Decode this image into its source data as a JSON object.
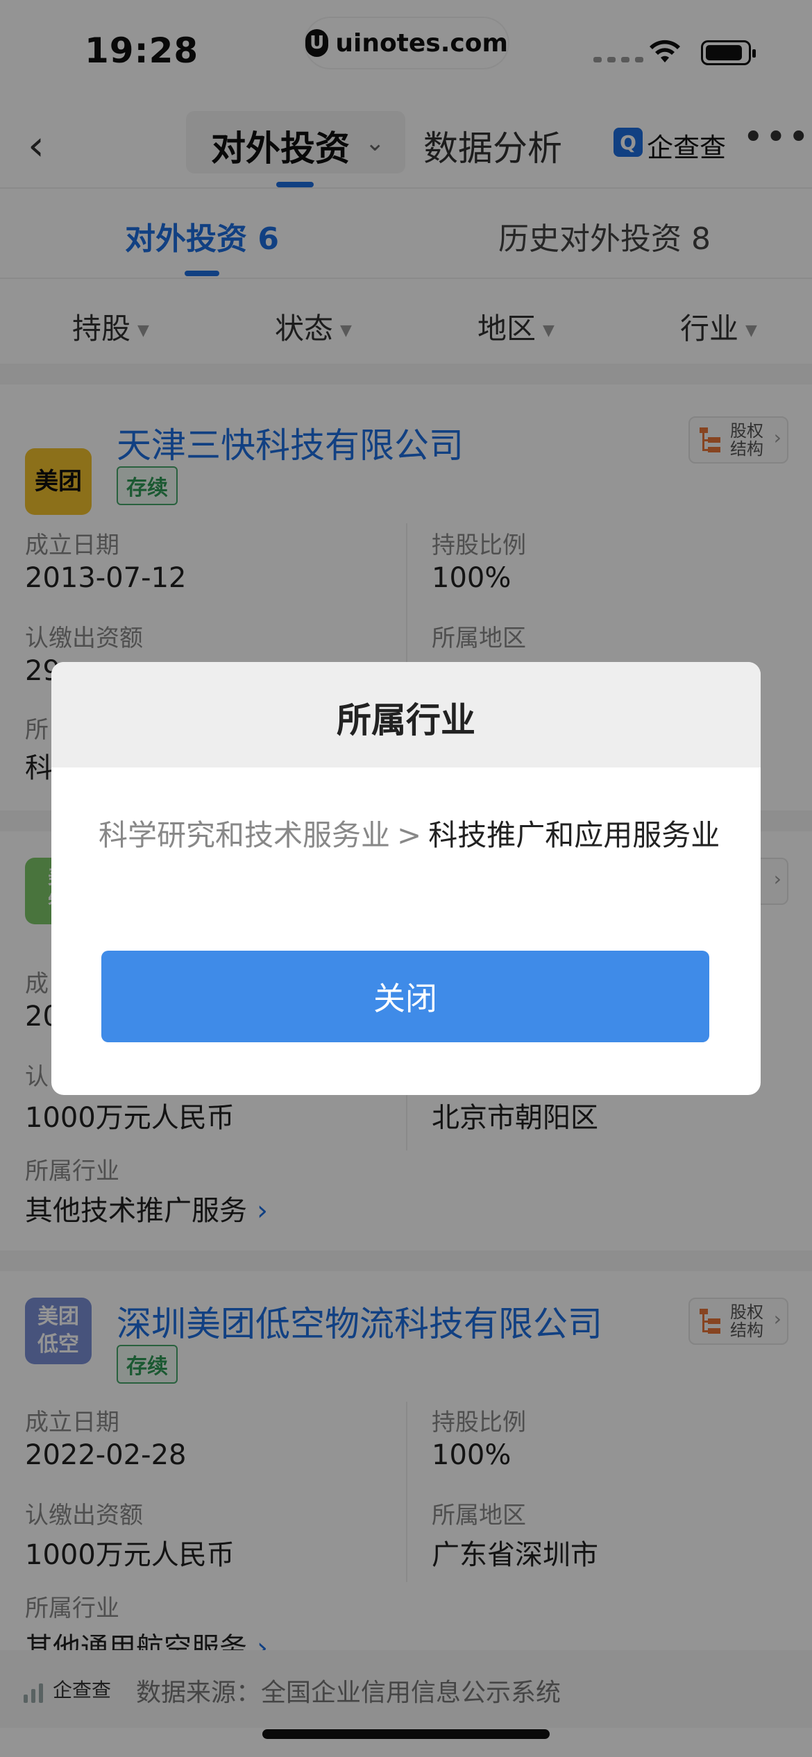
{
  "status_bar": {
    "time": "19:28",
    "pill_logo": "U",
    "pill_text": "uinotes.com"
  },
  "nav": {
    "back_icon": "‹",
    "tab_active": "对外投资",
    "tab_other": "数据分析",
    "brand_icon": "Q",
    "brand": "企查查",
    "more_icon": "•••"
  },
  "subtabs": {
    "active": "对外投资 6",
    "other": "历史对外投资 8"
  },
  "filters": [
    "持股",
    "状态",
    "地区",
    "行业"
  ],
  "cards": [
    {
      "logo": "美团",
      "logo_color": "#F2C12E",
      "logo_text_color": "#111111",
      "name": "天津三快科技有限公司",
      "status": "存续",
      "equity_label_1": "股权",
      "equity_label_2": "结构",
      "founded_label": "成立日期",
      "founded": "2013-07-12",
      "ratio_label": "持股比例",
      "ratio": "100%",
      "capital_label": "认缴出资额",
      "capital": "29",
      "region_label": "所属地区",
      "region": "",
      "industry_label": "所",
      "industry": "科"
    },
    {
      "logo": "美\n智",
      "logo_color": "#7FC86A",
      "name": "",
      "status": "",
      "founded_label": "成",
      "founded": "20",
      "capital_label": "认",
      "capital": "1000万元人民币",
      "region": "北京市朝阳区",
      "industry_label": "所属行业",
      "industry": "其他技术推广服务"
    },
    {
      "logo": "美团\n低空",
      "logo_color": "#7B8FD6",
      "name": "深圳美团低空物流科技有限公司",
      "status": "存续",
      "equity_label_1": "股权",
      "equity_label_2": "结构",
      "founded_label": "成立日期",
      "founded": "2022-02-28",
      "ratio_label": "持股比例",
      "ratio": "100%",
      "capital_label": "认缴出资额",
      "capital": "1000万元人民币",
      "region_label": "所属地区",
      "region": "广东省深圳市",
      "industry_label": "所属行业",
      "industry": "其他通用航空服务"
    }
  ],
  "footer": {
    "brand": "企查查",
    "source": "数据来源：全国企业信用信息公示系统"
  },
  "modal": {
    "title": "所属行业",
    "category": "科学研究和技术服务业",
    "separator": ">",
    "subcategory": "科技推广和应用服务业",
    "close_button": "关闭"
  },
  "colors": {
    "accent": "#1E6FE0",
    "button": "#3F8BE8",
    "status_green": "#2F9A57"
  }
}
